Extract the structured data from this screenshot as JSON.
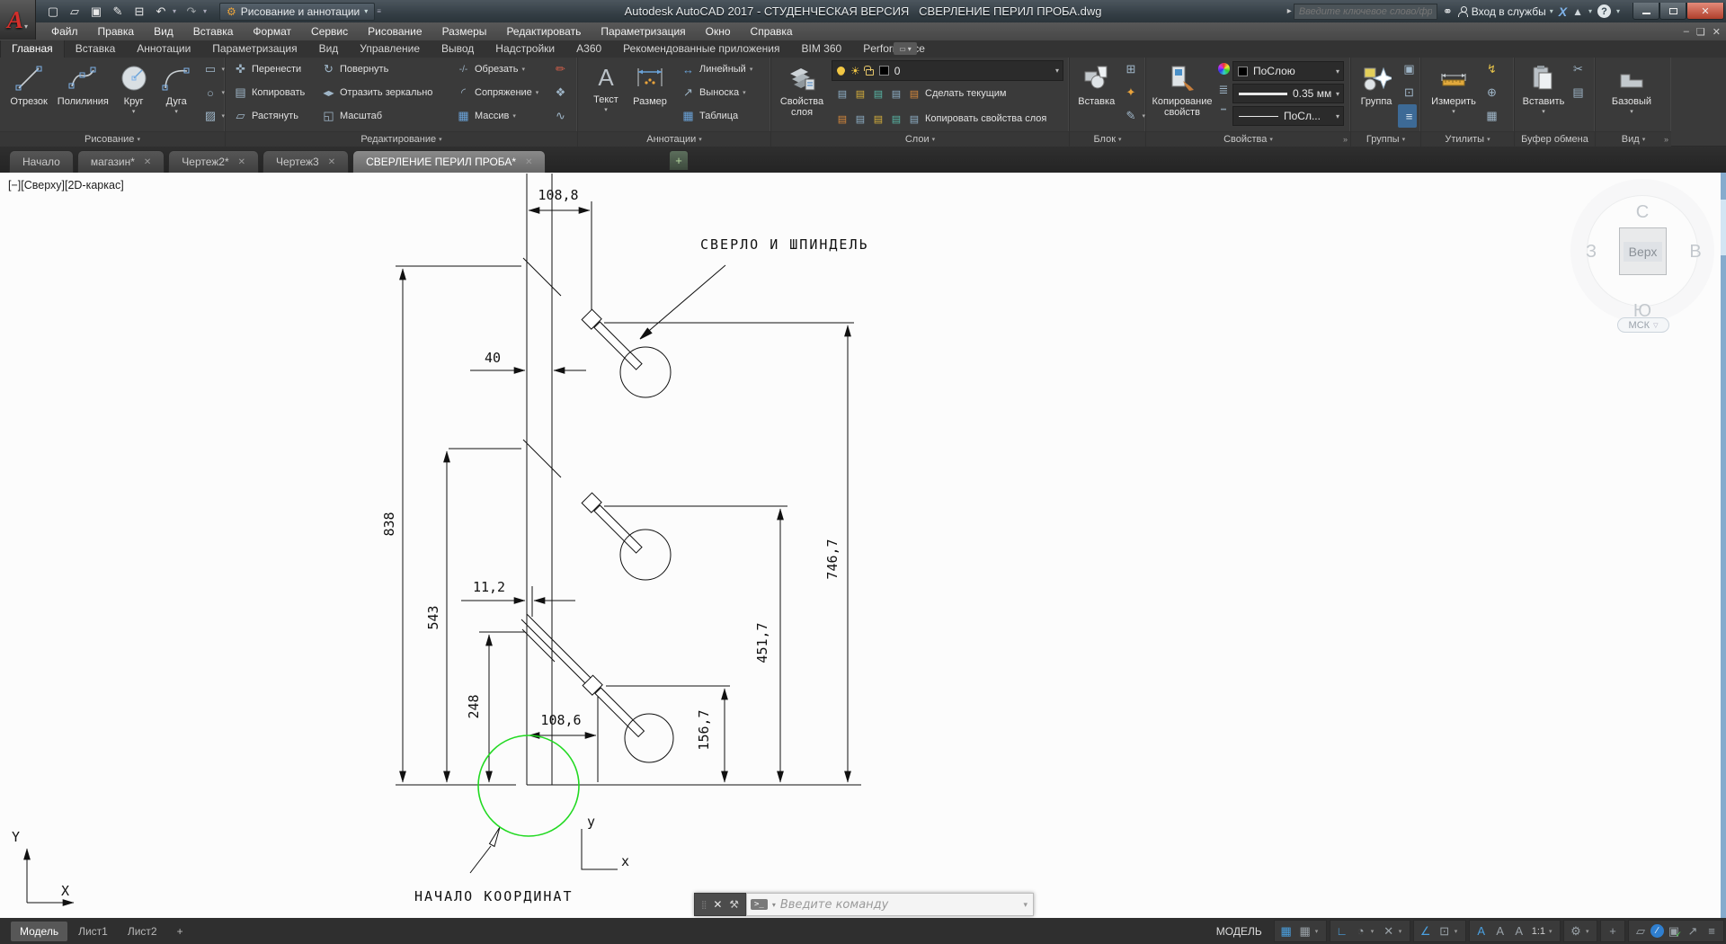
{
  "title_bar": {
    "title": "Autodesk AutoCAD 2017 - СТУДЕНЧЕСКАЯ ВЕРСИЯ   СВЕРЛЕНИЕ ПЕРИЛ ПРОБА.dwg",
    "workspace": "Рисование и аннотации",
    "search_placeholder": "Введите ключевое слово/фразу",
    "sign_in": "Вход в службы",
    "exchange": "X",
    "help": "?"
  },
  "menu": {
    "items": [
      "Файл",
      "Правка",
      "Вид",
      "Вставка",
      "Формат",
      "Сервис",
      "Рисование",
      "Размеры",
      "Редактировать",
      "Параметризация",
      "Окно",
      "Справка"
    ]
  },
  "ribbon": {
    "tabs": [
      {
        "label": "Главная",
        "active": true
      },
      {
        "label": "Вставка"
      },
      {
        "label": "Аннотации"
      },
      {
        "label": "Параметризация"
      },
      {
        "label": "Вид"
      },
      {
        "label": "Управление"
      },
      {
        "label": "Вывод"
      },
      {
        "label": "Надстройки"
      },
      {
        "label": "A360"
      },
      {
        "label": "Рекомендованные приложения"
      },
      {
        "label": "BIM 360"
      },
      {
        "label": "Performance"
      }
    ],
    "draw": {
      "label": "Рисование",
      "line": "Отрезок",
      "polyline": "Полилиния",
      "circle": "Круг",
      "arc": "Дуга"
    },
    "modify": {
      "label": "Редактирование",
      "move": "Перенести",
      "copy": "Копировать",
      "stretch": "Растянуть",
      "rotate": "Повернуть",
      "mirror": "Отразить зеркально",
      "scale": "Масштаб",
      "trim": "Обрезать",
      "fillet": "Сопряжение",
      "array": "Массив"
    },
    "annotate": {
      "label": "Аннотации",
      "text": "Текст",
      "dim": "Размер",
      "linear": "Линейный",
      "leader": "Выноска",
      "table": "Таблица"
    },
    "layers": {
      "label": "Слои",
      "props_l1": "Свойства",
      "props_l2": "слоя",
      "current": "0",
      "make_current": "Сделать текущим",
      "match": "Копировать свойства слоя"
    },
    "block": {
      "label": "Блок",
      "insert": "Вставка"
    },
    "properties": {
      "label": "Свойства",
      "match_l1": "Копирование",
      "match_l2": "свойств",
      "color": "ПоСлою",
      "lineweight": "0.35 мм",
      "linetype": "ПоСл..."
    },
    "groups": {
      "label": "Группы",
      "group": "Группа"
    },
    "utilities": {
      "label": "Утилиты",
      "measure": "Измерить"
    },
    "clipboard": {
      "label": "Буфер обмена",
      "paste": "Вставить"
    },
    "view": {
      "label": "Вид",
      "base": "Базовый"
    }
  },
  "file_tabs": {
    "tabs": [
      {
        "label": "Начало",
        "closable": false
      },
      {
        "label": "магазин*"
      },
      {
        "label": "Чертеж2*"
      },
      {
        "label": "Чертеж3"
      },
      {
        "label": "СВЕРЛЕНИЕ ПЕРИЛ ПРОБА*",
        "active": true
      }
    ]
  },
  "viewport": {
    "controls": "[−][Сверху][2D-каркас]"
  },
  "viewcube": {
    "north": "С",
    "south": "Ю",
    "west": "З",
    "east": "В",
    "top": "Верх",
    "wcs": "МСК"
  },
  "drawing": {
    "labels": {
      "spindle": "СВЕРЛО И ШПИНДЕЛЬ",
      "origin": "НАЧАЛО КООРДИНАТ",
      "axis_y": "у",
      "axis_x": "x",
      "ucs_y": "Y",
      "ucs_x": "X"
    },
    "dimensions": {
      "top_width": "108,8",
      "rail_width": "40",
      "height_total": "838",
      "height_mid": "543",
      "height_low": "248",
      "offset_small": "11,2",
      "bottom_width": "108,6",
      "spindle_low": "156,7",
      "spindle_mid": "451,7",
      "spindle_top": "746,7"
    },
    "accent_green": "#21d921"
  },
  "command_line": {
    "prompt": ">_",
    "placeholder": "Введите команду"
  },
  "status_bar": {
    "left_tabs": [
      {
        "label": "Модель",
        "active": true
      },
      {
        "label": "Лист1"
      },
      {
        "label": "Лист2"
      },
      {
        "label": "+"
      }
    ],
    "mode": "МОДЕЛЬ",
    "annotation_scale": "1:1"
  },
  "icons": {
    "new": "▢",
    "open": "▱",
    "save": "▣",
    "save_as": "✎",
    "plot": "⊟",
    "undo": "↶",
    "redo": "↷",
    "gear": "⚙",
    "menu_more": "≡",
    "search_go": "▸",
    "binoculars": "⚭",
    "a360": "▲",
    "dropdown": "▾",
    "min": "–",
    "close": "✕",
    "restore": "❏",
    "move": "✜",
    "rotate": "↻",
    "copy": "▤",
    "mirror": "◀▶",
    "stretch": "▱",
    "scale": "◱",
    "trim": "-/-",
    "fillet": "◜",
    "array": "▦",
    "erase": "✏",
    "explode": "❖",
    "offset": "∿",
    "rect": "▭",
    "ellipse": "○",
    "hatch": "▨",
    "text": "A",
    "linear": "↔",
    "leader": "↗",
    "table": "▦",
    "sun": "☀",
    "layer": "▤",
    "lw": "≣",
    "lt": "┅",
    "block1": "⊞",
    "block2": "✦",
    "block3": "✎",
    "grp1": "▣",
    "grp2": "⊡",
    "grp3": "≡",
    "util1": "↯",
    "util2": "⊕",
    "util3": "▦",
    "cut": "✂",
    "copyclip": "▤",
    "cmd_x": "✕",
    "wrench": "⚒",
    "grip": "⣿",
    "grid": "▦",
    "ortho": "∟",
    "polar": "◔",
    "iso": "✕",
    "osnap_angle": "∠",
    "osnap": "⊡",
    "annot": "А",
    "plus": "+",
    "isolate": "▱",
    "slash": "∕",
    "hw_box": "▣",
    "hw_check": "✓",
    "expand": "↗",
    "hamburger": "≡"
  }
}
